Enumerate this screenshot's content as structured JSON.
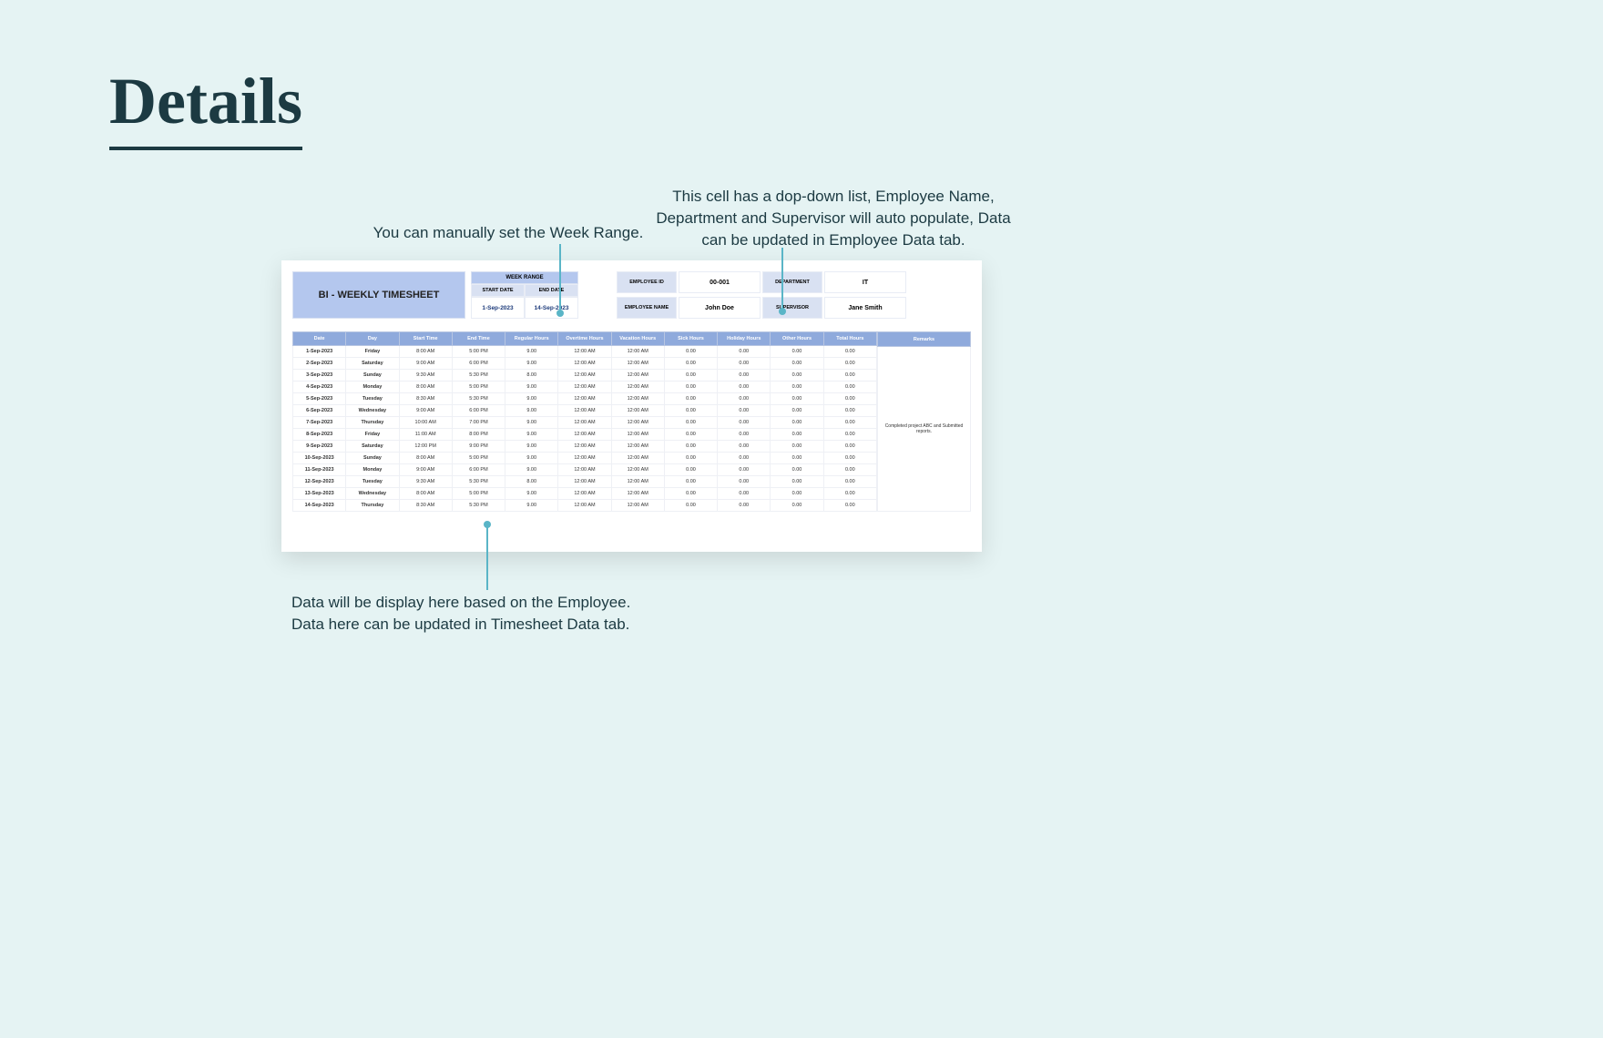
{
  "page": {
    "title": "Details"
  },
  "annotations": {
    "week_range": "You can manually set the Week Range.",
    "employee_dropdown": "This cell has a dop-down list, Employee Name, Department and Supervisor will auto populate, Data can be updated in Employee Data tab.",
    "data_display_1": "Data will be display here based on the Employee.",
    "data_display_2": "Data here can be updated in Timesheet Data tab."
  },
  "timesheet": {
    "title": "BI - WEEKLY TIMESHEET",
    "week_range": {
      "label": "WEEK RANGE",
      "start_label": "START DATE",
      "end_label": "END DATE",
      "start": "1-Sep-2023",
      "end": "14-Sep-2023"
    },
    "info": {
      "emp_id_label": "EMPLOYEE ID",
      "emp_id": "00-001",
      "dept_label": "DEPARTMENT",
      "dept": "IT",
      "emp_name_label": "EMPLOYEE NAME",
      "emp_name": "John Doe",
      "sup_label": "SUPERVISOR",
      "sup": "Jane Smith"
    },
    "columns": [
      "Date",
      "Day",
      "Start Time",
      "End Time",
      "Regular Hours",
      "Overtime Hours",
      "Vacation Hours",
      "Sick Hours",
      "Holiday Hours",
      "Other Hours",
      "Total Hours"
    ],
    "remarks_label": "Remarks",
    "remarks": "Completed project ABC and Submitted reports.",
    "rows": [
      {
        "date": "1-Sep-2023",
        "day": "Friday",
        "start": "8:00 AM",
        "end": "5:00 PM",
        "reg": "9.00",
        "ot": "12:00 AM",
        "vac": "12:00 AM",
        "sick": "0.00",
        "hol": "0.00",
        "oth": "0.00",
        "tot": "0.00"
      },
      {
        "date": "2-Sep-2023",
        "day": "Saturday",
        "start": "9:00 AM",
        "end": "6:00 PM",
        "reg": "9.00",
        "ot": "12:00 AM",
        "vac": "12:00 AM",
        "sick": "0.00",
        "hol": "0.00",
        "oth": "0.00",
        "tot": "0.00"
      },
      {
        "date": "3-Sep-2023",
        "day": "Sunday",
        "start": "9:30 AM",
        "end": "5:30 PM",
        "reg": "8.00",
        "ot": "12:00 AM",
        "vac": "12:00 AM",
        "sick": "0.00",
        "hol": "0.00",
        "oth": "0.00",
        "tot": "0.00"
      },
      {
        "date": "4-Sep-2023",
        "day": "Monday",
        "start": "8:00 AM",
        "end": "5:00 PM",
        "reg": "9.00",
        "ot": "12:00 AM",
        "vac": "12:00 AM",
        "sick": "0.00",
        "hol": "0.00",
        "oth": "0.00",
        "tot": "0.00"
      },
      {
        "date": "5-Sep-2023",
        "day": "Tuesday",
        "start": "8:30 AM",
        "end": "5:30 PM",
        "reg": "9.00",
        "ot": "12:00 AM",
        "vac": "12:00 AM",
        "sick": "0.00",
        "hol": "0.00",
        "oth": "0.00",
        "tot": "0.00"
      },
      {
        "date": "6-Sep-2023",
        "day": "Wednesday",
        "start": "9:00 AM",
        "end": "6:00 PM",
        "reg": "9.00",
        "ot": "12:00 AM",
        "vac": "12:00 AM",
        "sick": "0.00",
        "hol": "0.00",
        "oth": "0.00",
        "tot": "0.00"
      },
      {
        "date": "7-Sep-2023",
        "day": "Thursday",
        "start": "10:00 AM",
        "end": "7:00 PM",
        "reg": "9.00",
        "ot": "12:00 AM",
        "vac": "12:00 AM",
        "sick": "0.00",
        "hol": "0.00",
        "oth": "0.00",
        "tot": "0.00"
      },
      {
        "date": "8-Sep-2023",
        "day": "Friday",
        "start": "11:00 AM",
        "end": "8:00 PM",
        "reg": "9.00",
        "ot": "12:00 AM",
        "vac": "12:00 AM",
        "sick": "0.00",
        "hol": "0.00",
        "oth": "0.00",
        "tot": "0.00"
      },
      {
        "date": "9-Sep-2023",
        "day": "Saturday",
        "start": "12:00 PM",
        "end": "9:00 PM",
        "reg": "9.00",
        "ot": "12:00 AM",
        "vac": "12:00 AM",
        "sick": "0.00",
        "hol": "0.00",
        "oth": "0.00",
        "tot": "0.00"
      },
      {
        "date": "10-Sep-2023",
        "day": "Sunday",
        "start": "8:00 AM",
        "end": "5:00 PM",
        "reg": "9.00",
        "ot": "12:00 AM",
        "vac": "12:00 AM",
        "sick": "0.00",
        "hol": "0.00",
        "oth": "0.00",
        "tot": "0.00"
      },
      {
        "date": "11-Sep-2023",
        "day": "Monday",
        "start": "9:00 AM",
        "end": "6:00 PM",
        "reg": "9.00",
        "ot": "12:00 AM",
        "vac": "12:00 AM",
        "sick": "0.00",
        "hol": "0.00",
        "oth": "0.00",
        "tot": "0.00"
      },
      {
        "date": "12-Sep-2023",
        "day": "Tuesday",
        "start": "9:30 AM",
        "end": "5:30 PM",
        "reg": "8.00",
        "ot": "12:00 AM",
        "vac": "12:00 AM",
        "sick": "0.00",
        "hol": "0.00",
        "oth": "0.00",
        "tot": "0.00"
      },
      {
        "date": "13-Sep-2023",
        "day": "Wednesday",
        "start": "8:00 AM",
        "end": "5:00 PM",
        "reg": "9.00",
        "ot": "12:00 AM",
        "vac": "12:00 AM",
        "sick": "0.00",
        "hol": "0.00",
        "oth": "0.00",
        "tot": "0.00"
      },
      {
        "date": "14-Sep-2023",
        "day": "Thursday",
        "start": "8:30 AM",
        "end": "5:30 PM",
        "reg": "9.00",
        "ot": "12:00 AM",
        "vac": "12:00 AM",
        "sick": "0.00",
        "hol": "0.00",
        "oth": "0.00",
        "tot": "0.00"
      }
    ]
  }
}
